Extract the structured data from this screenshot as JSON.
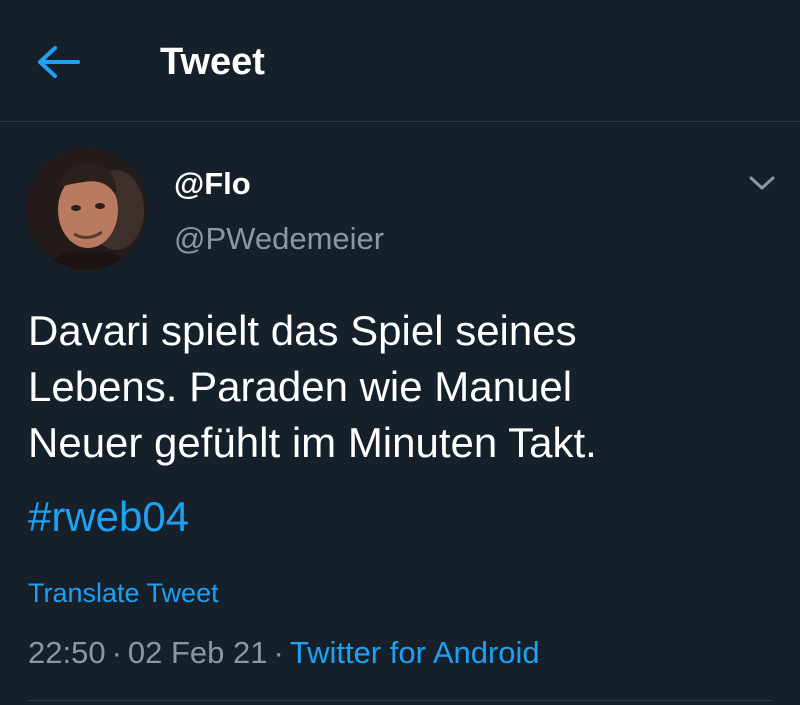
{
  "header": {
    "title": "Tweet",
    "back_icon": "arrow-left-icon"
  },
  "tweet": {
    "display_name": "@Flo",
    "handle": "@PWedemeier",
    "text": "Davari spielt das Spiel seines\nLebens. Paraden wie Manuel\nNeuer gefühlt im Minuten Takt.",
    "hashtag": "#rweb04",
    "translate_label": "Translate Tweet",
    "time": "22:50",
    "separator": "·",
    "date": "02 Feb 21",
    "source": "Twitter for Android",
    "menu_icon": "chevron-down-icon"
  },
  "colors": {
    "background": "#15202b",
    "accent": "#1da1f2",
    "secondary_text": "#8899a6",
    "divider": "#2f3b47"
  }
}
